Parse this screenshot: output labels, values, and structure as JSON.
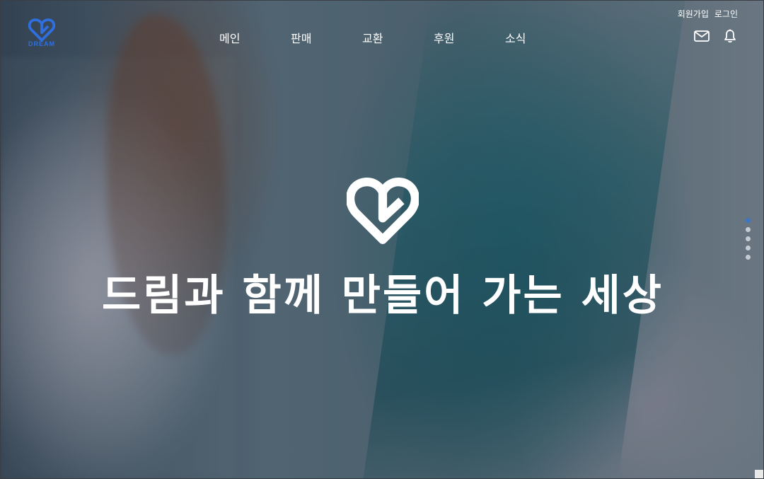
{
  "logo": {
    "text": "DREAM",
    "color": "#2f6fe0"
  },
  "nav": {
    "items": [
      {
        "label": "메인"
      },
      {
        "label": "판매"
      },
      {
        "label": "교환"
      },
      {
        "label": "후원"
      },
      {
        "label": "소식"
      }
    ]
  },
  "top_links": {
    "signup": "회원가입",
    "login": "로그인"
  },
  "icons": {
    "mail": "mail-icon",
    "bell": "bell-icon"
  },
  "hero": {
    "headline": "드림과 함께 만들어 가는 세상",
    "slides": {
      "count": 5,
      "active_index": 0
    }
  },
  "colors": {
    "accent": "#3d76c7",
    "overlay": "#1e2d3d"
  }
}
